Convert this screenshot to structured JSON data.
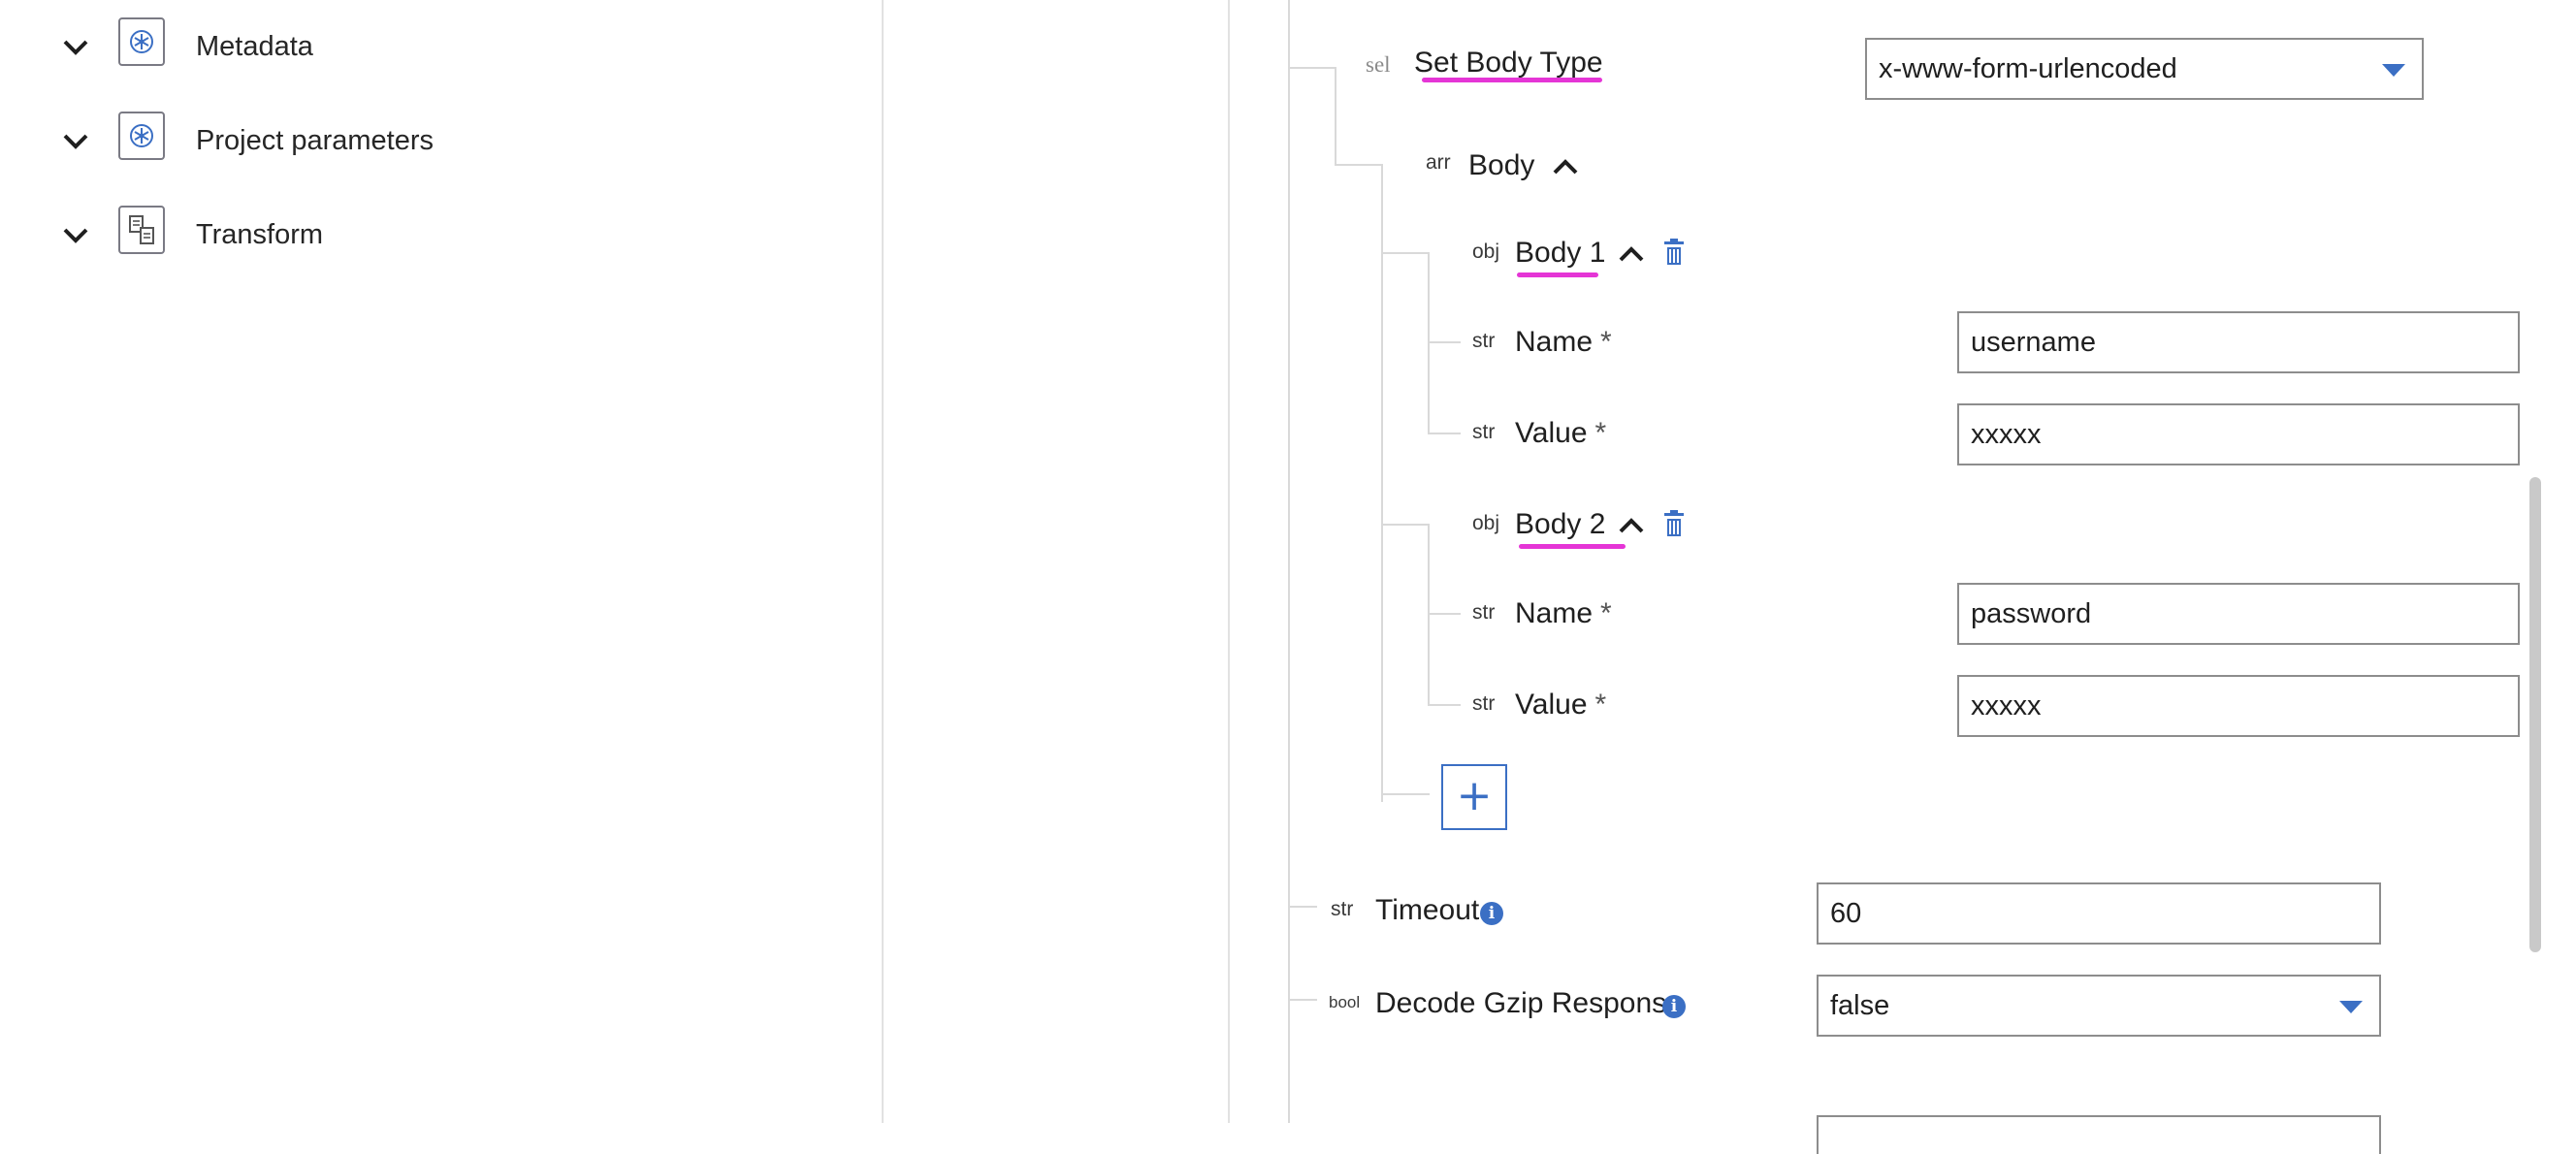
{
  "left_panel": {
    "items": [
      {
        "label": "Metadata",
        "icon": "api-component-icon"
      },
      {
        "label": "Project parameters",
        "icon": "api-component-icon"
      },
      {
        "label": "Transform",
        "icon": "transform-icon"
      }
    ]
  },
  "form": {
    "set_body_type": {
      "type": "sel",
      "label": "Set Body Type",
      "value": "x-www-form-urlencoded"
    },
    "body": {
      "type": "arr",
      "label": "Body",
      "items": [
        {
          "type": "obj",
          "label": "Body 1",
          "name": {
            "type": "str",
            "label": "Name",
            "required_mark": "*",
            "value": "username"
          },
          "value": {
            "type": "str",
            "label": "Value",
            "required_mark": "*",
            "value": "xxxxx"
          }
        },
        {
          "type": "obj",
          "label": "Body 2",
          "name": {
            "type": "str",
            "label": "Name",
            "required_mark": "*",
            "value": "password"
          },
          "value": {
            "type": "str",
            "label": "Value",
            "required_mark": "*",
            "value": "xxxxx"
          }
        }
      ],
      "add_symbol": "+"
    },
    "timeout": {
      "type": "str",
      "label": "Timeout",
      "value": "60"
    },
    "decode_gzip": {
      "type": "bool",
      "label": "Decode Gzip Response",
      "value": "false"
    }
  },
  "colors": {
    "accent": "#3b6fc4",
    "highlight": "#e535d6",
    "border": "#8d8d8d"
  }
}
